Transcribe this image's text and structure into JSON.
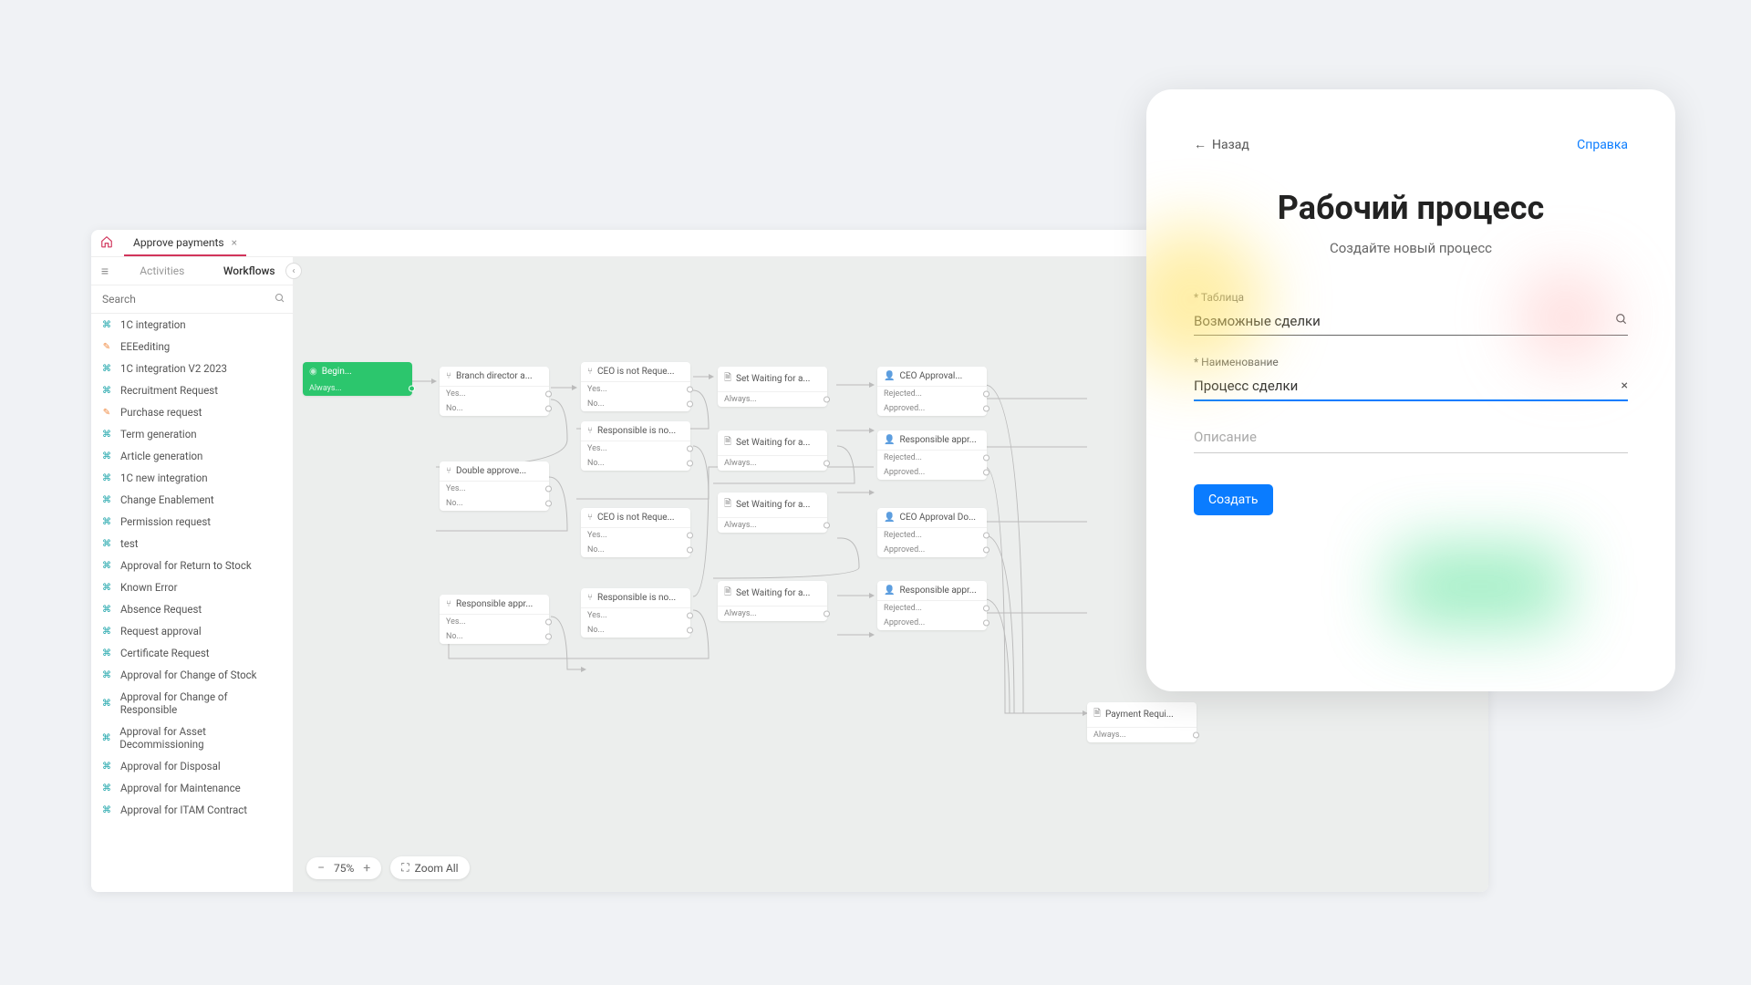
{
  "titlebar": {
    "tab_title": "Approve payments"
  },
  "sidebar": {
    "tabs": {
      "activities": "Activities",
      "workflows": "Workflows"
    },
    "search_placeholder": "Search",
    "items": [
      {
        "label": "1C integration",
        "icon": "teal"
      },
      {
        "label": "EEEediting",
        "icon": "orange"
      },
      {
        "label": "1C integration V2 2023",
        "icon": "teal"
      },
      {
        "label": "Recruitment Request",
        "icon": "teal"
      },
      {
        "label": "Purchase request",
        "icon": "orange"
      },
      {
        "label": "Term generation",
        "icon": "teal"
      },
      {
        "label": "Article generation",
        "icon": "teal"
      },
      {
        "label": "1C new integration",
        "icon": "teal"
      },
      {
        "label": "Change Enablement",
        "icon": "teal"
      },
      {
        "label": "Permission request",
        "icon": "teal"
      },
      {
        "label": "test",
        "icon": "teal"
      },
      {
        "label": "Approval for Return to Stock",
        "icon": "teal"
      },
      {
        "label": "Known Error",
        "icon": "teal"
      },
      {
        "label": "Absence Request",
        "icon": "teal"
      },
      {
        "label": "Request approval",
        "icon": "teal"
      },
      {
        "label": "Certificate Request",
        "icon": "teal"
      },
      {
        "label": "Approval for Change of Stock",
        "icon": "teal"
      },
      {
        "label": "Approval for Change of Responsible",
        "icon": "teal"
      },
      {
        "label": "Approval for Asset Decommissioning",
        "icon": "teal"
      },
      {
        "label": "Approval for Disposal",
        "icon": "teal"
      },
      {
        "label": "Approval for Maintenance",
        "icon": "teal"
      },
      {
        "label": "Approval for ITAM Contract",
        "icon": "teal"
      }
    ]
  },
  "canvas": {
    "zoom_pct": "75%",
    "zoom_all": "Zoom All",
    "out_always": "Always...",
    "out_yes": "Yes...",
    "out_no": "No...",
    "out_rejected": "Rejected...",
    "out_approved": "Approved...",
    "nodes": {
      "begin": "Begin...",
      "branch": "Branch director a...",
      "ceo1": "CEO is not Reque...",
      "wait1": "Set Waiting for a...",
      "ceoapp": "CEO Approval...",
      "double": "Double approve...",
      "resp1": "Responsible is no...",
      "wait2": "Set Waiting for a...",
      "respapp1": "Responsible appr...",
      "ceo2": "CEO is not Reque...",
      "wait3": "Set Waiting for a...",
      "ceoappdo": "CEO Approval Do...",
      "resp2": "Responsible is no...",
      "wait4": "Set Waiting for a...",
      "respapp2": "Responsible appr...",
      "respappr3": "Responsible appr...",
      "payreq": "Payment Requi..."
    }
  },
  "modal": {
    "back": "Назад",
    "help": "Справка",
    "title": "Рабочий процесс",
    "subtitle": "Создайте новый процесс",
    "field_table_label": "* Таблица",
    "field_table_value": "Возможные сделки",
    "field_name_label": "* Наименование",
    "field_name_value": "Процесс сделки",
    "field_desc_placeholder": "Описание",
    "create": "Создать"
  }
}
